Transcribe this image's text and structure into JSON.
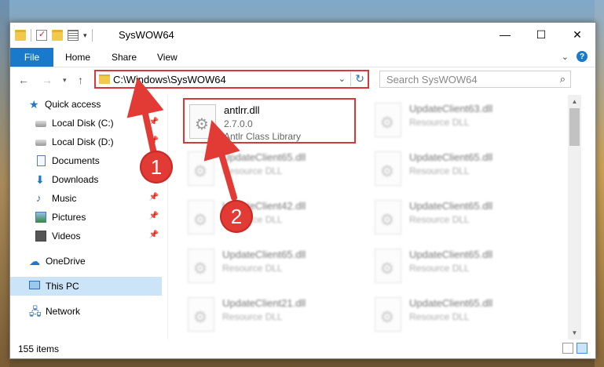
{
  "window": {
    "title": "SysWOW64",
    "controls": {
      "minimize": "—",
      "maximize": "☐",
      "close": "✕"
    }
  },
  "ribbon": {
    "tabs": [
      "File",
      "Home",
      "Share",
      "View"
    ]
  },
  "address": {
    "path": "C:\\Windows\\SysWOW64",
    "search_placeholder": "Search SysWOW64"
  },
  "sidebar": {
    "items": [
      {
        "label": "Quick access",
        "icon": "star-icon",
        "pinned": false
      },
      {
        "label": "Local Disk (C:)",
        "icon": "disk-icon",
        "pinned": true
      },
      {
        "label": "Local Disk (D:)",
        "icon": "disk-icon",
        "pinned": true
      },
      {
        "label": "Documents",
        "icon": "document-icon",
        "pinned": true
      },
      {
        "label": "Downloads",
        "icon": "download-icon",
        "pinned": true
      },
      {
        "label": "Music",
        "icon": "music-icon",
        "pinned": true
      },
      {
        "label": "Pictures",
        "icon": "pictures-icon",
        "pinned": true
      },
      {
        "label": "Videos",
        "icon": "videos-icon",
        "pinned": true
      },
      {
        "label": "OneDrive",
        "icon": "cloud-icon",
        "pinned": false
      },
      {
        "label": "This PC",
        "icon": "computer-icon",
        "pinned": false,
        "selected": true
      },
      {
        "label": "Network",
        "icon": "network-icon",
        "pinned": false
      }
    ]
  },
  "files": {
    "main": {
      "name": "antlrr.dll",
      "version": "2.7.0.0",
      "description": "Antlr Class Library"
    },
    "col1_blurred": [
      {
        "name": "UpdateClient65.dll",
        "type": "Resource DLL"
      },
      {
        "name": "UpdateClient42.dll",
        "type": "Resource DLL"
      },
      {
        "name": "UpdateClient65.dll",
        "type": "Resource DLL"
      },
      {
        "name": "UpdateClient21.dll",
        "type": "Resource DLL"
      }
    ],
    "col2_blurred": [
      {
        "name": "UpdateClient63.dll",
        "type": "Resource DLL"
      },
      {
        "name": "UpdateClient65.dll",
        "type": "Resource DLL"
      },
      {
        "name": "UpdateClient65.dll",
        "type": "Resource DLL"
      },
      {
        "name": "UpdateClient65.dll",
        "type": "Resource DLL"
      },
      {
        "name": "UpdateClient65.dll",
        "type": "Resource DLL"
      }
    ]
  },
  "status": {
    "item_count": "155 items"
  },
  "annotations": {
    "step1": "1",
    "step2": "2"
  }
}
